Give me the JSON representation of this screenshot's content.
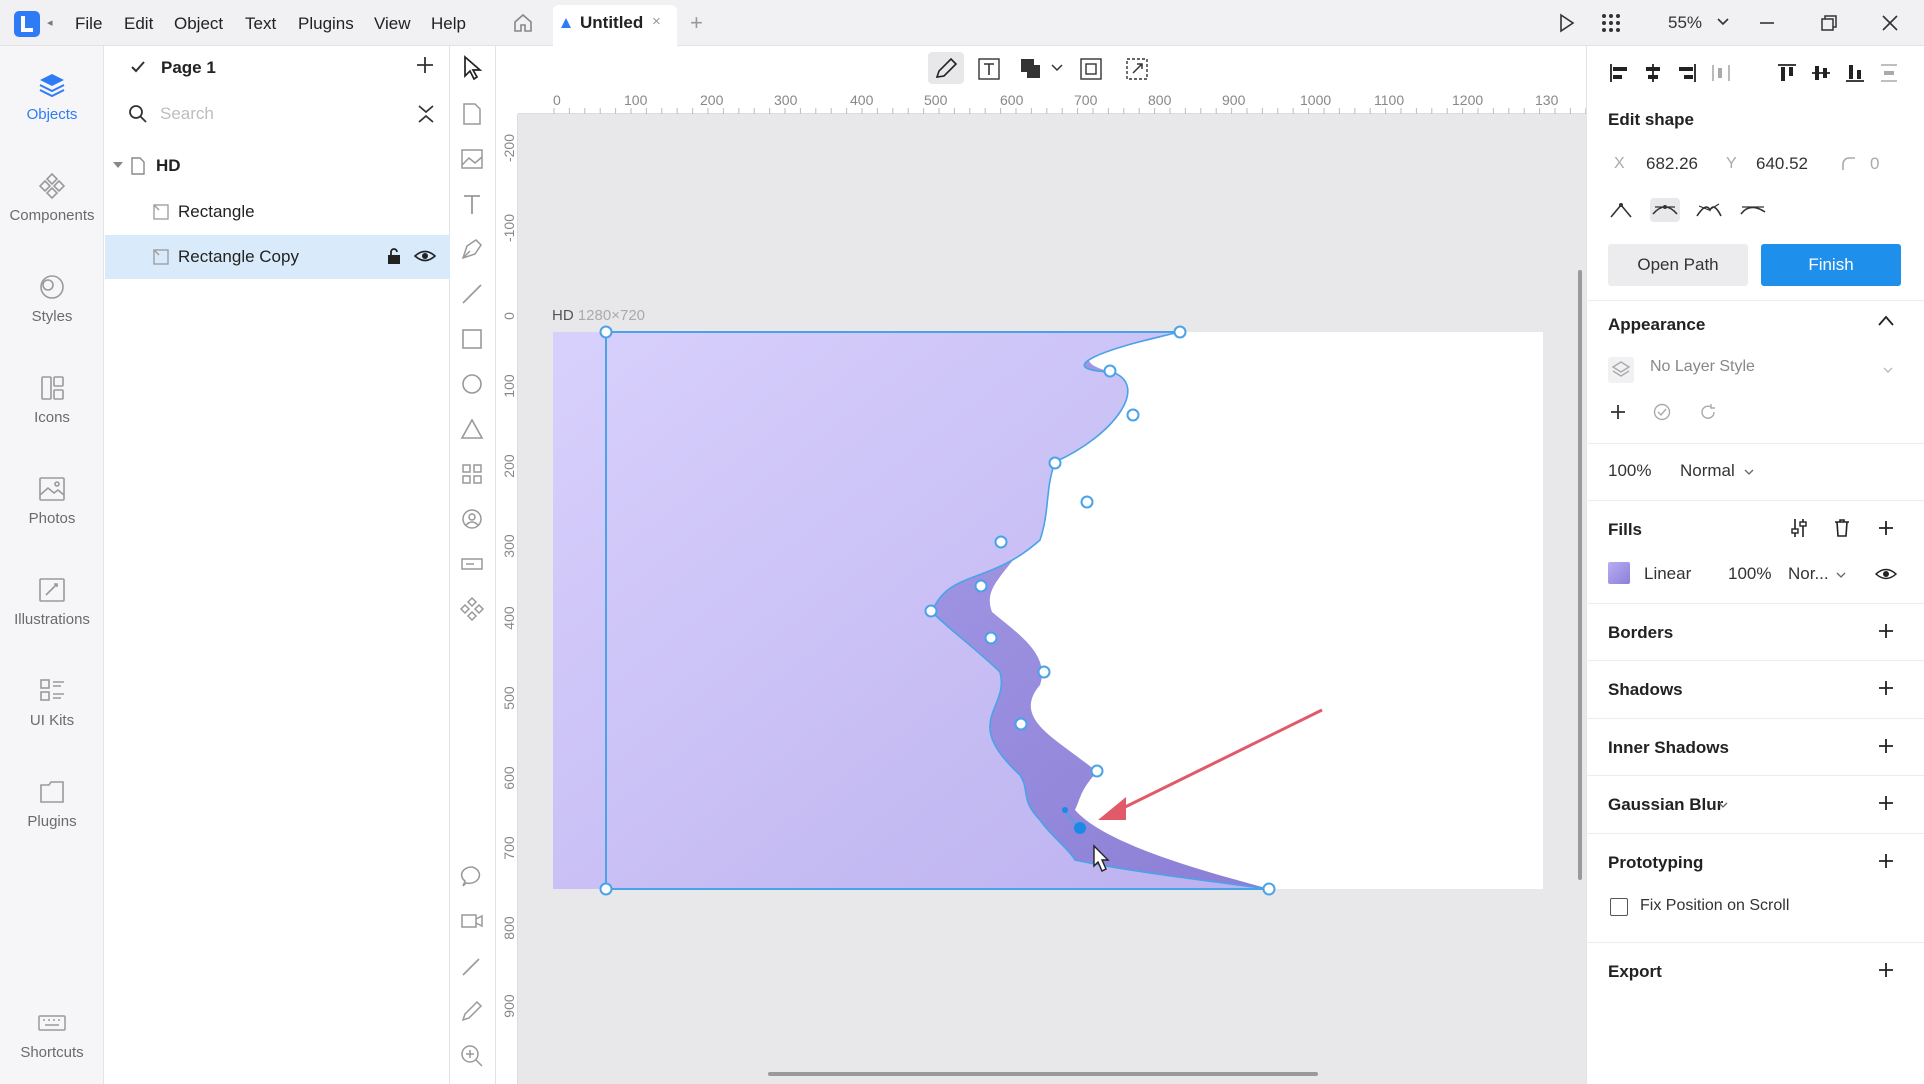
{
  "menu": {
    "items": [
      "File",
      "Edit",
      "Object",
      "Text",
      "Plugins",
      "View",
      "Help"
    ]
  },
  "tab": {
    "title": "Untitled",
    "close": "×",
    "new": "+"
  },
  "window": {
    "zoom": "55%"
  },
  "rail": {
    "items": [
      "Objects",
      "Components",
      "Styles",
      "Icons",
      "Photos",
      "Illustrations",
      "UI Kits",
      "Plugins",
      "Shortcuts"
    ]
  },
  "layers": {
    "page": "Page 1",
    "search_placeholder": "Search",
    "artboard": "HD",
    "items": [
      "Rectangle",
      "Rectangle Copy"
    ]
  },
  "ruler": {
    "top": [
      "0",
      "100",
      "200",
      "300",
      "400",
      "500",
      "600",
      "700",
      "800",
      "900",
      "1000",
      "1100",
      "1200",
      "130"
    ],
    "left": [
      "-200",
      "-100",
      "0",
      "100",
      "200",
      "300",
      "400",
      "500",
      "600",
      "700",
      "800",
      "900"
    ]
  },
  "canvas": {
    "artboard_name": "HD",
    "artboard_size": "1280×720"
  },
  "inspector": {
    "title": "Edit shape",
    "x_label": "X",
    "x": "682.26",
    "y_label": "Y",
    "y": "640.52",
    "radius": "0",
    "open_path": "Open Path",
    "finish": "Finish",
    "appearance": "Appearance",
    "layer_style": "No Layer Style",
    "opacity": "100%",
    "blend": "Normal",
    "fills": "Fills",
    "fill_type": "Linear",
    "fill_opacity": "100%",
    "fill_blend": "Nor...",
    "borders": "Borders",
    "shadows": "Shadows",
    "inner_shadows": "Inner Shadows",
    "gaussian_blur": "Gaussian Blur",
    "prototyping": "Prototyping",
    "fix_position": "Fix Position on Scroll",
    "export": "Export"
  },
  "colors": {
    "accent": "#2f7bf6",
    "finish_button": "#1f8fec",
    "fill_start": "#d5ccfb",
    "fill_end": "#8e82d4",
    "arrow": "#e05a6a",
    "selection": "#4aa3e8"
  }
}
